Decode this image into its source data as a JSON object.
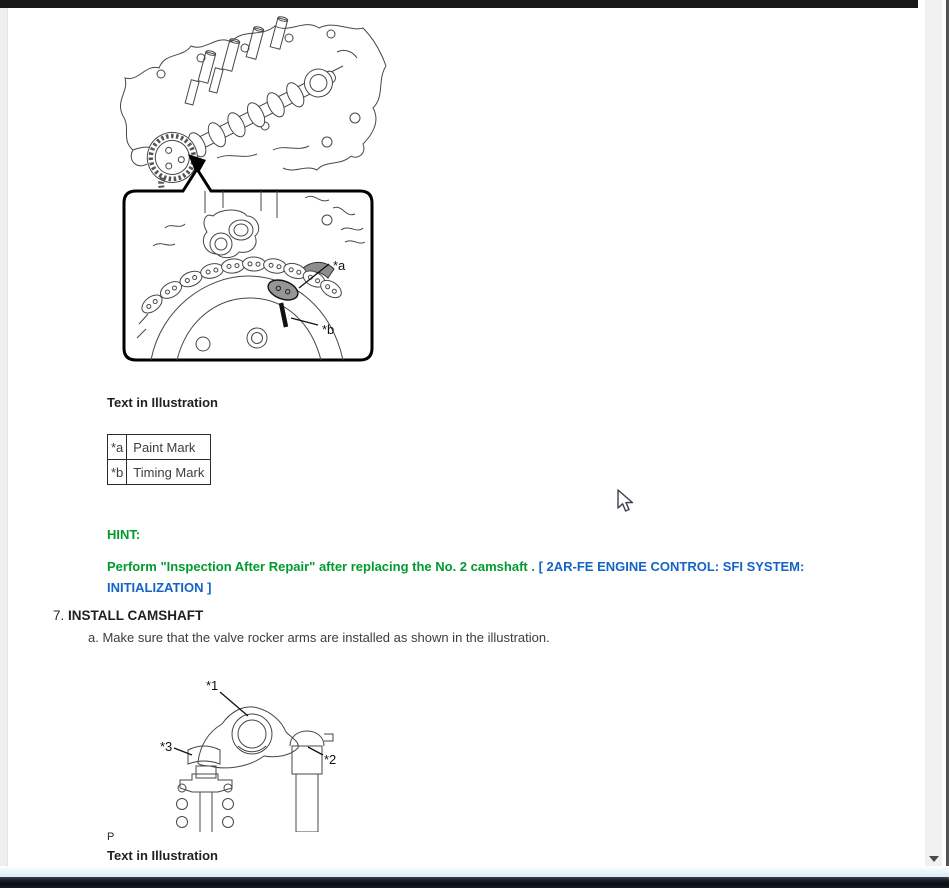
{
  "colors": {
    "hint_green": "#009b2f",
    "link_blue": "#1464c8"
  },
  "content": {
    "figure1": {
      "labels": {
        "a": "*a",
        "b": "*b"
      }
    },
    "text_in_illustration_heading": "Text in Illustration",
    "illustration_table": {
      "rows": [
        [
          "*a",
          "Paint Mark"
        ],
        [
          "*b",
          "Timing Mark"
        ]
      ]
    },
    "hint": {
      "label": "HINT:",
      "text": "Perform \"Inspection After Repair\" after replacing the No. 2 camshaft . ",
      "link_text": "[ 2AR-FE ENGINE CONTROL: SFI SYSTEM: INITIALIZATION ]"
    },
    "step": {
      "number": "7.",
      "title": "INSTALL CAMSHAFT"
    },
    "substep": {
      "letter": "a.",
      "text": "Make sure that the valve rocker arms are installed as shown in the illustration."
    },
    "figure2": {
      "labels": {
        "l1": "*1",
        "l2": "*2",
        "l3": "*3"
      },
      "page_mark": "P"
    },
    "text_in_illustration_heading2": "Text in Illustration"
  }
}
